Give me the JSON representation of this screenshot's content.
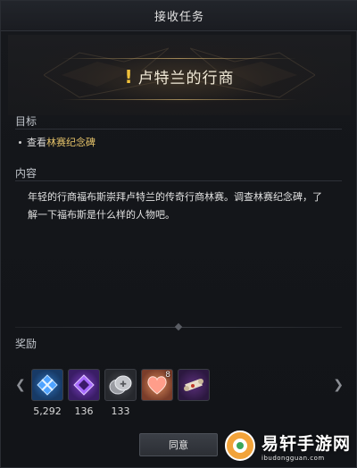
{
  "window": {
    "title": "接收任务"
  },
  "quest": {
    "icon": "exclamation-icon",
    "name": "卢特兰的行商"
  },
  "objective": {
    "label": "目标",
    "prefix": "查看",
    "target": "林赛纪念碑"
  },
  "content": {
    "label": "内容",
    "text": "年轻的行商福布斯崇拜卢特兰的传奇行商林赛。调查林赛纪念碑，了解一下福布斯是什么样的人物吧。"
  },
  "rewards": {
    "label": "奖励",
    "items": [
      {
        "icon": "blue-crystal-icon",
        "quantity": "5,292",
        "badge": ""
      },
      {
        "icon": "purple-crystal-icon",
        "quantity": "136",
        "badge": ""
      },
      {
        "icon": "silver-coin-icon",
        "quantity": "133",
        "badge": ""
      },
      {
        "icon": "heart-icon",
        "quantity": "",
        "badge": "8"
      },
      {
        "icon": "scroll-icon",
        "quantity": "",
        "badge": ""
      }
    ]
  },
  "buttons": {
    "agree": "同意"
  },
  "watermark": {
    "main": "易轩手游网",
    "sub": "ibudongguan.com"
  },
  "colors": {
    "highlight": "#e7c46a",
    "exclamation": "#f0c03a"
  }
}
